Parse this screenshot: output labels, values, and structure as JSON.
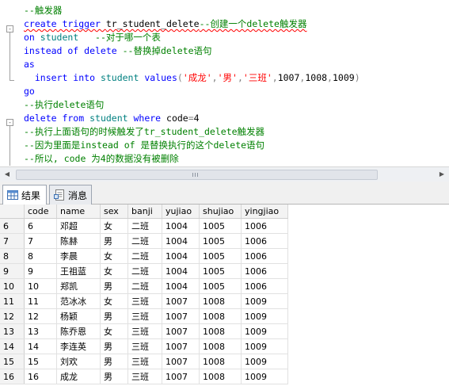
{
  "editor": {
    "lines": [
      [
        {
          "t": "--触发器",
          "c": "cm"
        }
      ],
      [
        {
          "t": "create",
          "c": "kw squiggle"
        },
        {
          "t": " trigger ",
          "c": "kw squiggle"
        },
        {
          "t": "tr_student_delete",
          "c": "squiggle"
        },
        {
          "t": "--创建一个delete触发器",
          "c": "cm squiggle"
        }
      ],
      [
        {
          "t": "on",
          "c": "kw"
        },
        {
          "t": " student ",
          "c": "sys"
        },
        {
          "t": "  --对于哪一个表",
          "c": "cm"
        }
      ],
      [
        {
          "t": "instead of delete",
          "c": "kw"
        },
        {
          "t": " --替换掉delete语句",
          "c": "cm"
        }
      ],
      [
        {
          "t": "as",
          "c": "kw"
        }
      ],
      [
        {
          "t": "  insert into",
          "c": "kw"
        },
        {
          "t": " student ",
          "c": "sys"
        },
        {
          "t": "values",
          "c": "kw"
        },
        {
          "t": "(",
          "c": "op"
        },
        {
          "t": "'成龙'",
          "c": "str"
        },
        {
          "t": ",",
          "c": "op"
        },
        {
          "t": "'男'",
          "c": "str"
        },
        {
          "t": ",",
          "c": "op"
        },
        {
          "t": "'三班'",
          "c": "str"
        },
        {
          "t": ",",
          "c": "op"
        },
        {
          "t": "1007",
          "c": "num"
        },
        {
          "t": ",",
          "c": "op"
        },
        {
          "t": "1008",
          "c": "num"
        },
        {
          "t": ",",
          "c": "op"
        },
        {
          "t": "1009",
          "c": "num"
        },
        {
          "t": ")",
          "c": "op"
        }
      ],
      [
        {
          "t": "go",
          "c": "kw"
        }
      ],
      [
        {
          "t": "--执行delete语句",
          "c": "cm"
        }
      ],
      [
        {
          "t": "delete from",
          "c": "kw"
        },
        {
          "t": " student ",
          "c": "sys"
        },
        {
          "t": "where",
          "c": "kw"
        },
        {
          "t": " code",
          "c": "num"
        },
        {
          "t": "=",
          "c": "op"
        },
        {
          "t": "4",
          "c": "num"
        }
      ],
      [
        {
          "t": "--执行上面语句的时候触发了tr_student_delete触发器",
          "c": "cm"
        }
      ],
      [
        {
          "t": "--因为里面是instead of 是替换执行的这个delete语句",
          "c": "cm"
        }
      ],
      [
        {
          "t": "--所以, code 为4的数据没有被删除",
          "c": "cm"
        }
      ]
    ],
    "fold_markers": [
      "-",
      "-"
    ]
  },
  "results_tabs": [
    {
      "label": "结果",
      "icon": "grid-icon"
    },
    {
      "label": "消息",
      "icon": "message-icon"
    }
  ],
  "grid": {
    "columns": [
      "code",
      "name",
      "sex",
      "banji",
      "yujiao",
      "shujiao",
      "yingjiao"
    ],
    "rows": [
      {
        "rownum": "6",
        "cells": [
          "6",
          "邓超",
          "女",
          "二班",
          "1004",
          "1005",
          "1006"
        ]
      },
      {
        "rownum": "7",
        "cells": [
          "7",
          "陈赫",
          "男",
          "二班",
          "1004",
          "1005",
          "1006"
        ]
      },
      {
        "rownum": "8",
        "cells": [
          "8",
          "李晨",
          "女",
          "二班",
          "1004",
          "1005",
          "1006"
        ]
      },
      {
        "rownum": "9",
        "cells": [
          "9",
          "王祖蓝",
          "女",
          "二班",
          "1004",
          "1005",
          "1006"
        ]
      },
      {
        "rownum": "10",
        "cells": [
          "10",
          "郑凯",
          "男",
          "二班",
          "1004",
          "1005",
          "1006"
        ]
      },
      {
        "rownum": "11",
        "cells": [
          "11",
          "范冰冰",
          "女",
          "三班",
          "1007",
          "1008",
          "1009"
        ]
      },
      {
        "rownum": "12",
        "cells": [
          "12",
          "杨颖",
          "男",
          "三班",
          "1007",
          "1008",
          "1009"
        ]
      },
      {
        "rownum": "13",
        "cells": [
          "13",
          "陈乔恩",
          "女",
          "三班",
          "1007",
          "1008",
          "1009"
        ]
      },
      {
        "rownum": "14",
        "cells": [
          "14",
          "李连英",
          "男",
          "三班",
          "1007",
          "1008",
          "1009"
        ]
      },
      {
        "rownum": "15",
        "cells": [
          "15",
          "刘欢",
          "男",
          "三班",
          "1007",
          "1008",
          "1009"
        ]
      },
      {
        "rownum": "16",
        "cells": [
          "16",
          "成龙",
          "男",
          "三班",
          "1007",
          "1008",
          "1009"
        ]
      }
    ]
  }
}
